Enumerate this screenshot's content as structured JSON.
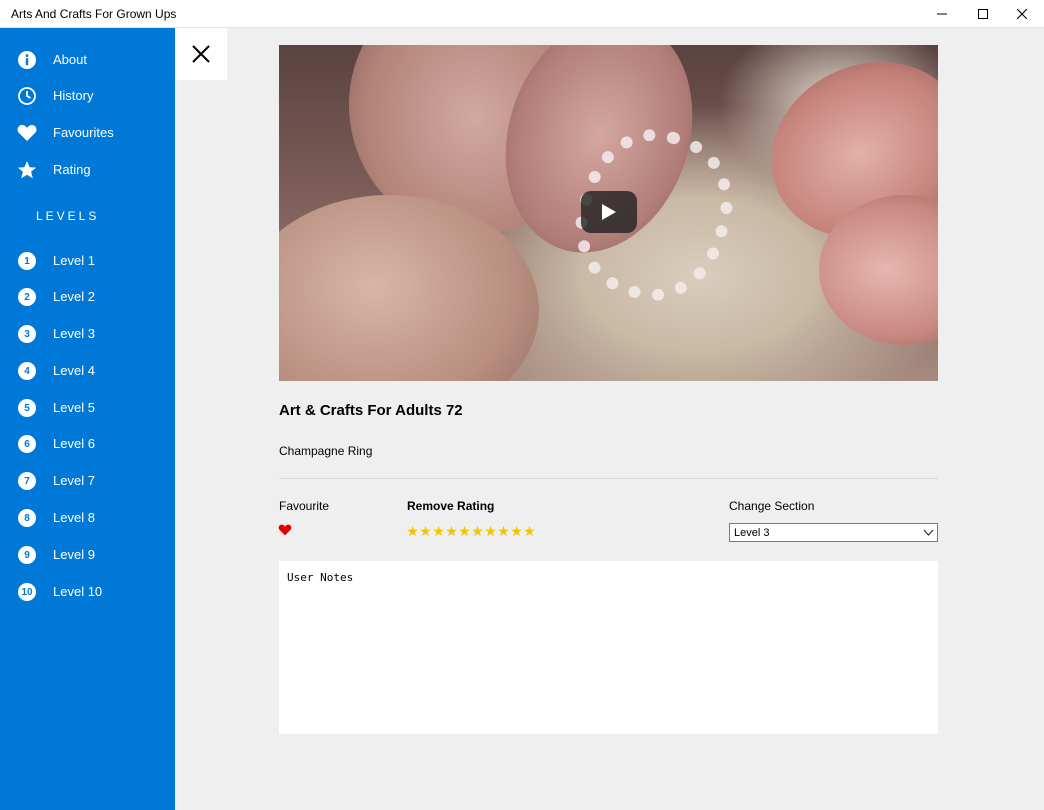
{
  "window": {
    "title": "Arts And Crafts For Grown Ups"
  },
  "sidebar": {
    "items": [
      {
        "label": "About",
        "icon": "info-icon"
      },
      {
        "label": "History",
        "icon": "clock-icon"
      },
      {
        "label": "Favourites",
        "icon": "heart-icon"
      },
      {
        "label": "Rating",
        "icon": "star-icon"
      }
    ],
    "levels_heading": "LEVELS",
    "levels": [
      {
        "num": "1",
        "label": "Level 1"
      },
      {
        "num": "2",
        "label": "Level 2"
      },
      {
        "num": "3",
        "label": "Level 3"
      },
      {
        "num": "4",
        "label": "Level 4"
      },
      {
        "num": "5",
        "label": "Level 5"
      },
      {
        "num": "6",
        "label": "Level 6"
      },
      {
        "num": "7",
        "label": "Level 7"
      },
      {
        "num": "8",
        "label": "Level 8"
      },
      {
        "num": "9",
        "label": "Level 9"
      },
      {
        "num": "10",
        "label": "Level 10"
      }
    ],
    "accent_color": "#0078d7"
  },
  "detail": {
    "title": "Art & Crafts For Adults 72",
    "subtitle": "Champagne Ring",
    "favourite_label": "Favourite",
    "favourite_color": "#e00000",
    "rating_label": "Remove Rating",
    "rating_value": 10,
    "rating_max": 10,
    "star_color": "#f3c400",
    "section_label": "Change Section",
    "section_value": "Level 3",
    "notes_text": "User Notes"
  }
}
